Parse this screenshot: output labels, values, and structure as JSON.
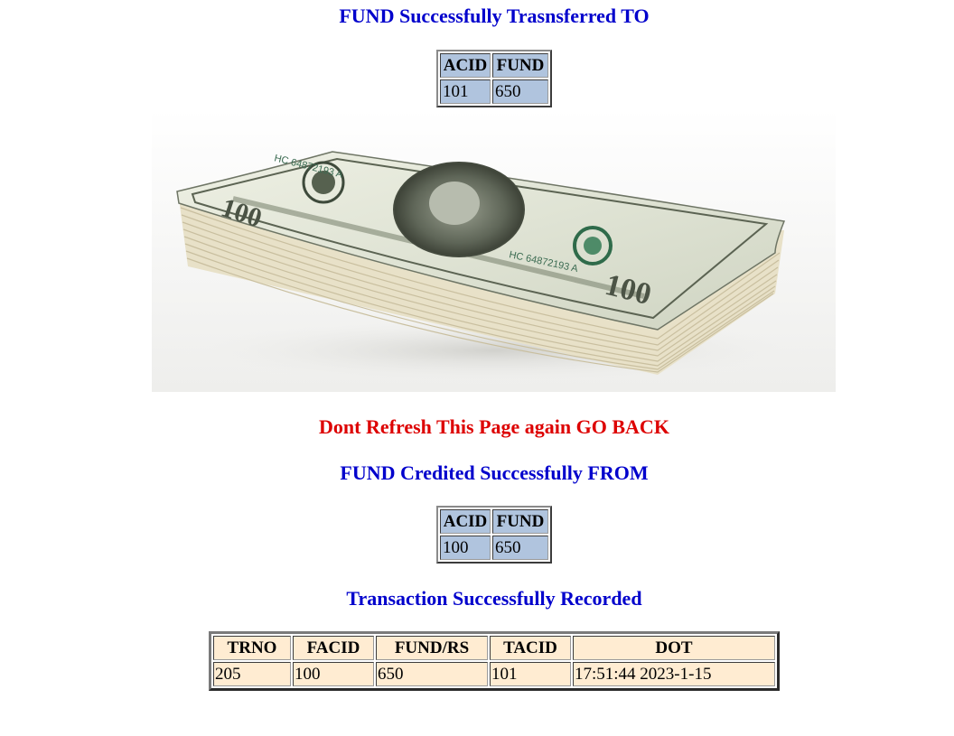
{
  "headings": {
    "to": "FUND Successfully Trasnsferred TO",
    "warning": "Dont Refresh This Page again GO BACK",
    "from": "FUND Credited Successfully FROM",
    "recorded": "Transaction Successfully Recorded"
  },
  "to_table": {
    "headers": [
      "ACID",
      "FUND"
    ],
    "row": [
      "101",
      "650"
    ]
  },
  "from_table": {
    "headers": [
      "ACID",
      "FUND"
    ],
    "row": [
      "100",
      "650"
    ]
  },
  "transaction_table": {
    "headers": [
      "TRNO",
      "FACID",
      "FUND/RS",
      "TACID",
      "DOT"
    ],
    "row": [
      "205",
      "100",
      "650",
      "101",
      "17:51:44 2023-1-15"
    ]
  },
  "banknote": {
    "serial": "HC 64872193 A",
    "denomination": "100"
  },
  "colors": {
    "heading_blue": "#0000cc",
    "warning_red": "#dd0000",
    "account_cell": "#b0c4de",
    "transaction_cell": "#ffecd2"
  }
}
